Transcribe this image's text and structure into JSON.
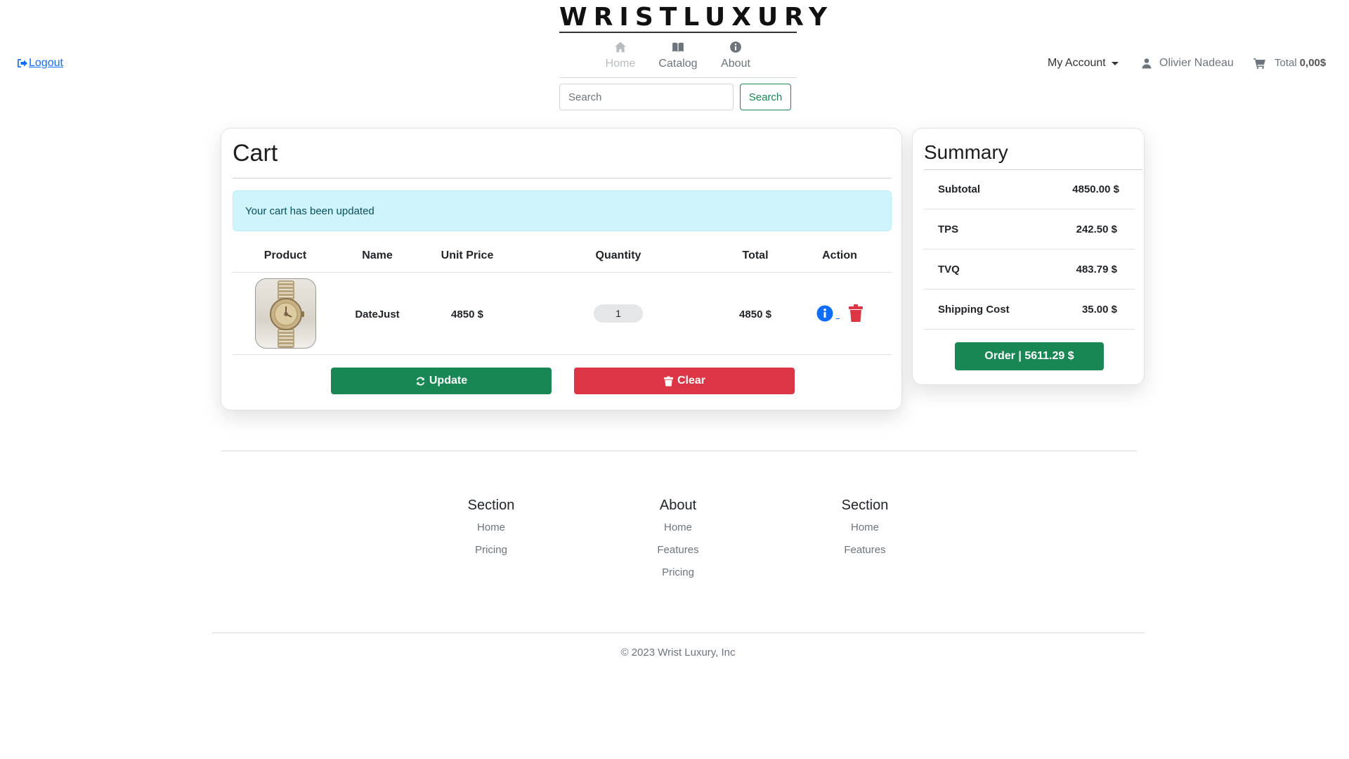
{
  "brand": {
    "name": "WRISTLUXURY"
  },
  "nav": {
    "items": [
      {
        "label": "Home",
        "icon": "home-icon"
      },
      {
        "label": "Catalog",
        "icon": "book-open-icon"
      },
      {
        "label": "About",
        "icon": "info-circle-icon"
      }
    ]
  },
  "search": {
    "placeholder": "Search",
    "button_label": "Search"
  },
  "header": {
    "logout_label": "Logout",
    "account_label": "My Account",
    "user_name": "Olivier Nadeau",
    "cart_total_label": "Total",
    "cart_total_value": "0,00$"
  },
  "cart": {
    "title": "Cart",
    "alert": "Your cart has been updated",
    "columns": [
      "Product",
      "Name",
      "Unit Price",
      "Quantity",
      "Total",
      "Action"
    ],
    "items": [
      {
        "name": "DateJust",
        "unit_price": "4850 $",
        "quantity": "1",
        "total": "4850 $"
      }
    ],
    "update_label": "Update",
    "clear_label": "Clear"
  },
  "summary": {
    "title": "Summary",
    "rows": [
      {
        "label": "Subtotal",
        "value": "4850.00 $"
      },
      {
        "label": "TPS",
        "value": "242.50 $"
      },
      {
        "label": "TVQ",
        "value": "483.79 $"
      },
      {
        "label": "Shipping Cost",
        "value": "35.00 $"
      }
    ],
    "order_label": "Order | 5611.29 $"
  },
  "footer": {
    "columns": [
      {
        "title": "Section",
        "links": [
          "Home",
          "Pricing"
        ]
      },
      {
        "title": "About",
        "links": [
          "Home",
          "Features",
          "Pricing"
        ]
      },
      {
        "title": "Section",
        "links": [
          "Home",
          "Features"
        ]
      }
    ],
    "copyright": "© 2023 Wrist Luxury, Inc"
  },
  "colors": {
    "primary": "#198754",
    "danger": "#dc3545",
    "link": "#0d6efd",
    "info_bg": "#cff4fc"
  }
}
